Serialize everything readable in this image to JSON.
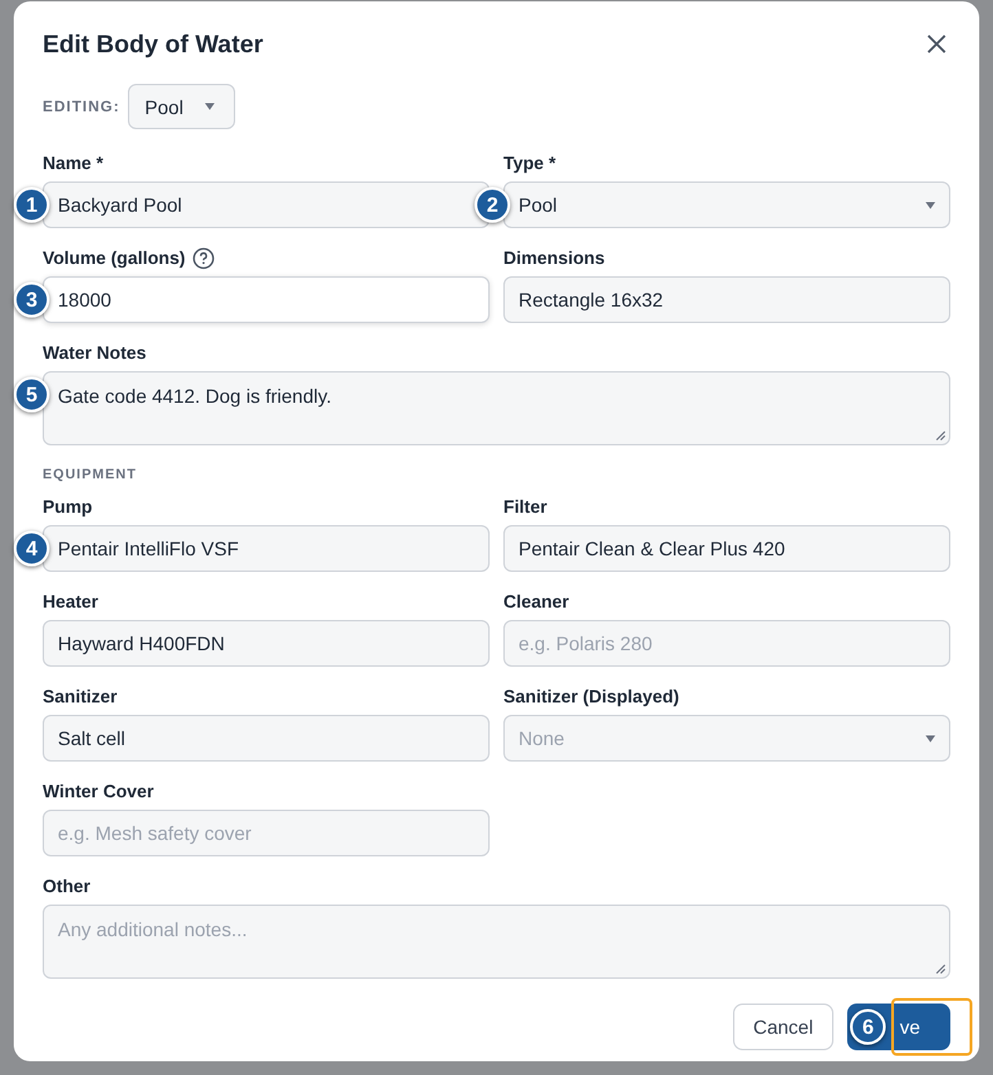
{
  "dialog": {
    "title": "Edit Body of Water"
  },
  "editing": {
    "label": "EDITING:",
    "value": "Pool"
  },
  "fields": [
    {
      "label": "Name *",
      "kind": "input",
      "value": "Backyard Pool",
      "marker": "1"
    },
    {
      "label": "Type *",
      "kind": "select",
      "value": "Pool",
      "marker": "2"
    },
    {
      "label": "Volume (gallons)",
      "kind": "input",
      "value": "18000",
      "help": true,
      "focused": true,
      "marker": "3"
    },
    {
      "label": "Dimensions",
      "kind": "input",
      "value": "Rectangle 16x32"
    },
    {
      "label": "Water Notes",
      "kind": "textarea",
      "value": "Gate code 4412. Dog is friendly.",
      "marker": "5"
    }
  ],
  "equipment": {
    "heading": "EQUIPMENT",
    "fields": [
      {
        "label": "Pump",
        "kind": "input",
        "value": "Pentair IntelliFlo VSF",
        "marker": "4"
      },
      {
        "label": "Filter",
        "kind": "input",
        "value": "Pentair Clean & Clear Plus 420"
      },
      {
        "label": "Heater",
        "kind": "input",
        "value": "Hayward H400FDN"
      },
      {
        "label": "Cleaner",
        "kind": "input",
        "placeholder": "e.g. Polaris 280"
      },
      {
        "label": "Sanitizer",
        "kind": "input",
        "value": "Salt cell"
      },
      {
        "label": "Sanitizer (Displayed)",
        "kind": "select",
        "placeholder": "None"
      },
      {
        "label": "Winter Cover",
        "kind": "input",
        "placeholder": "e.g. Mesh safety cover"
      },
      {
        "label": "Other",
        "kind": "textarea",
        "placeholder": "Any additional notes..."
      }
    ]
  },
  "buttons": [
    {
      "kind": "cancel",
      "label": "Cancel"
    },
    {
      "kind": "primary",
      "label": "ve",
      "marker": "6",
      "highlighted": true
    }
  ]
}
